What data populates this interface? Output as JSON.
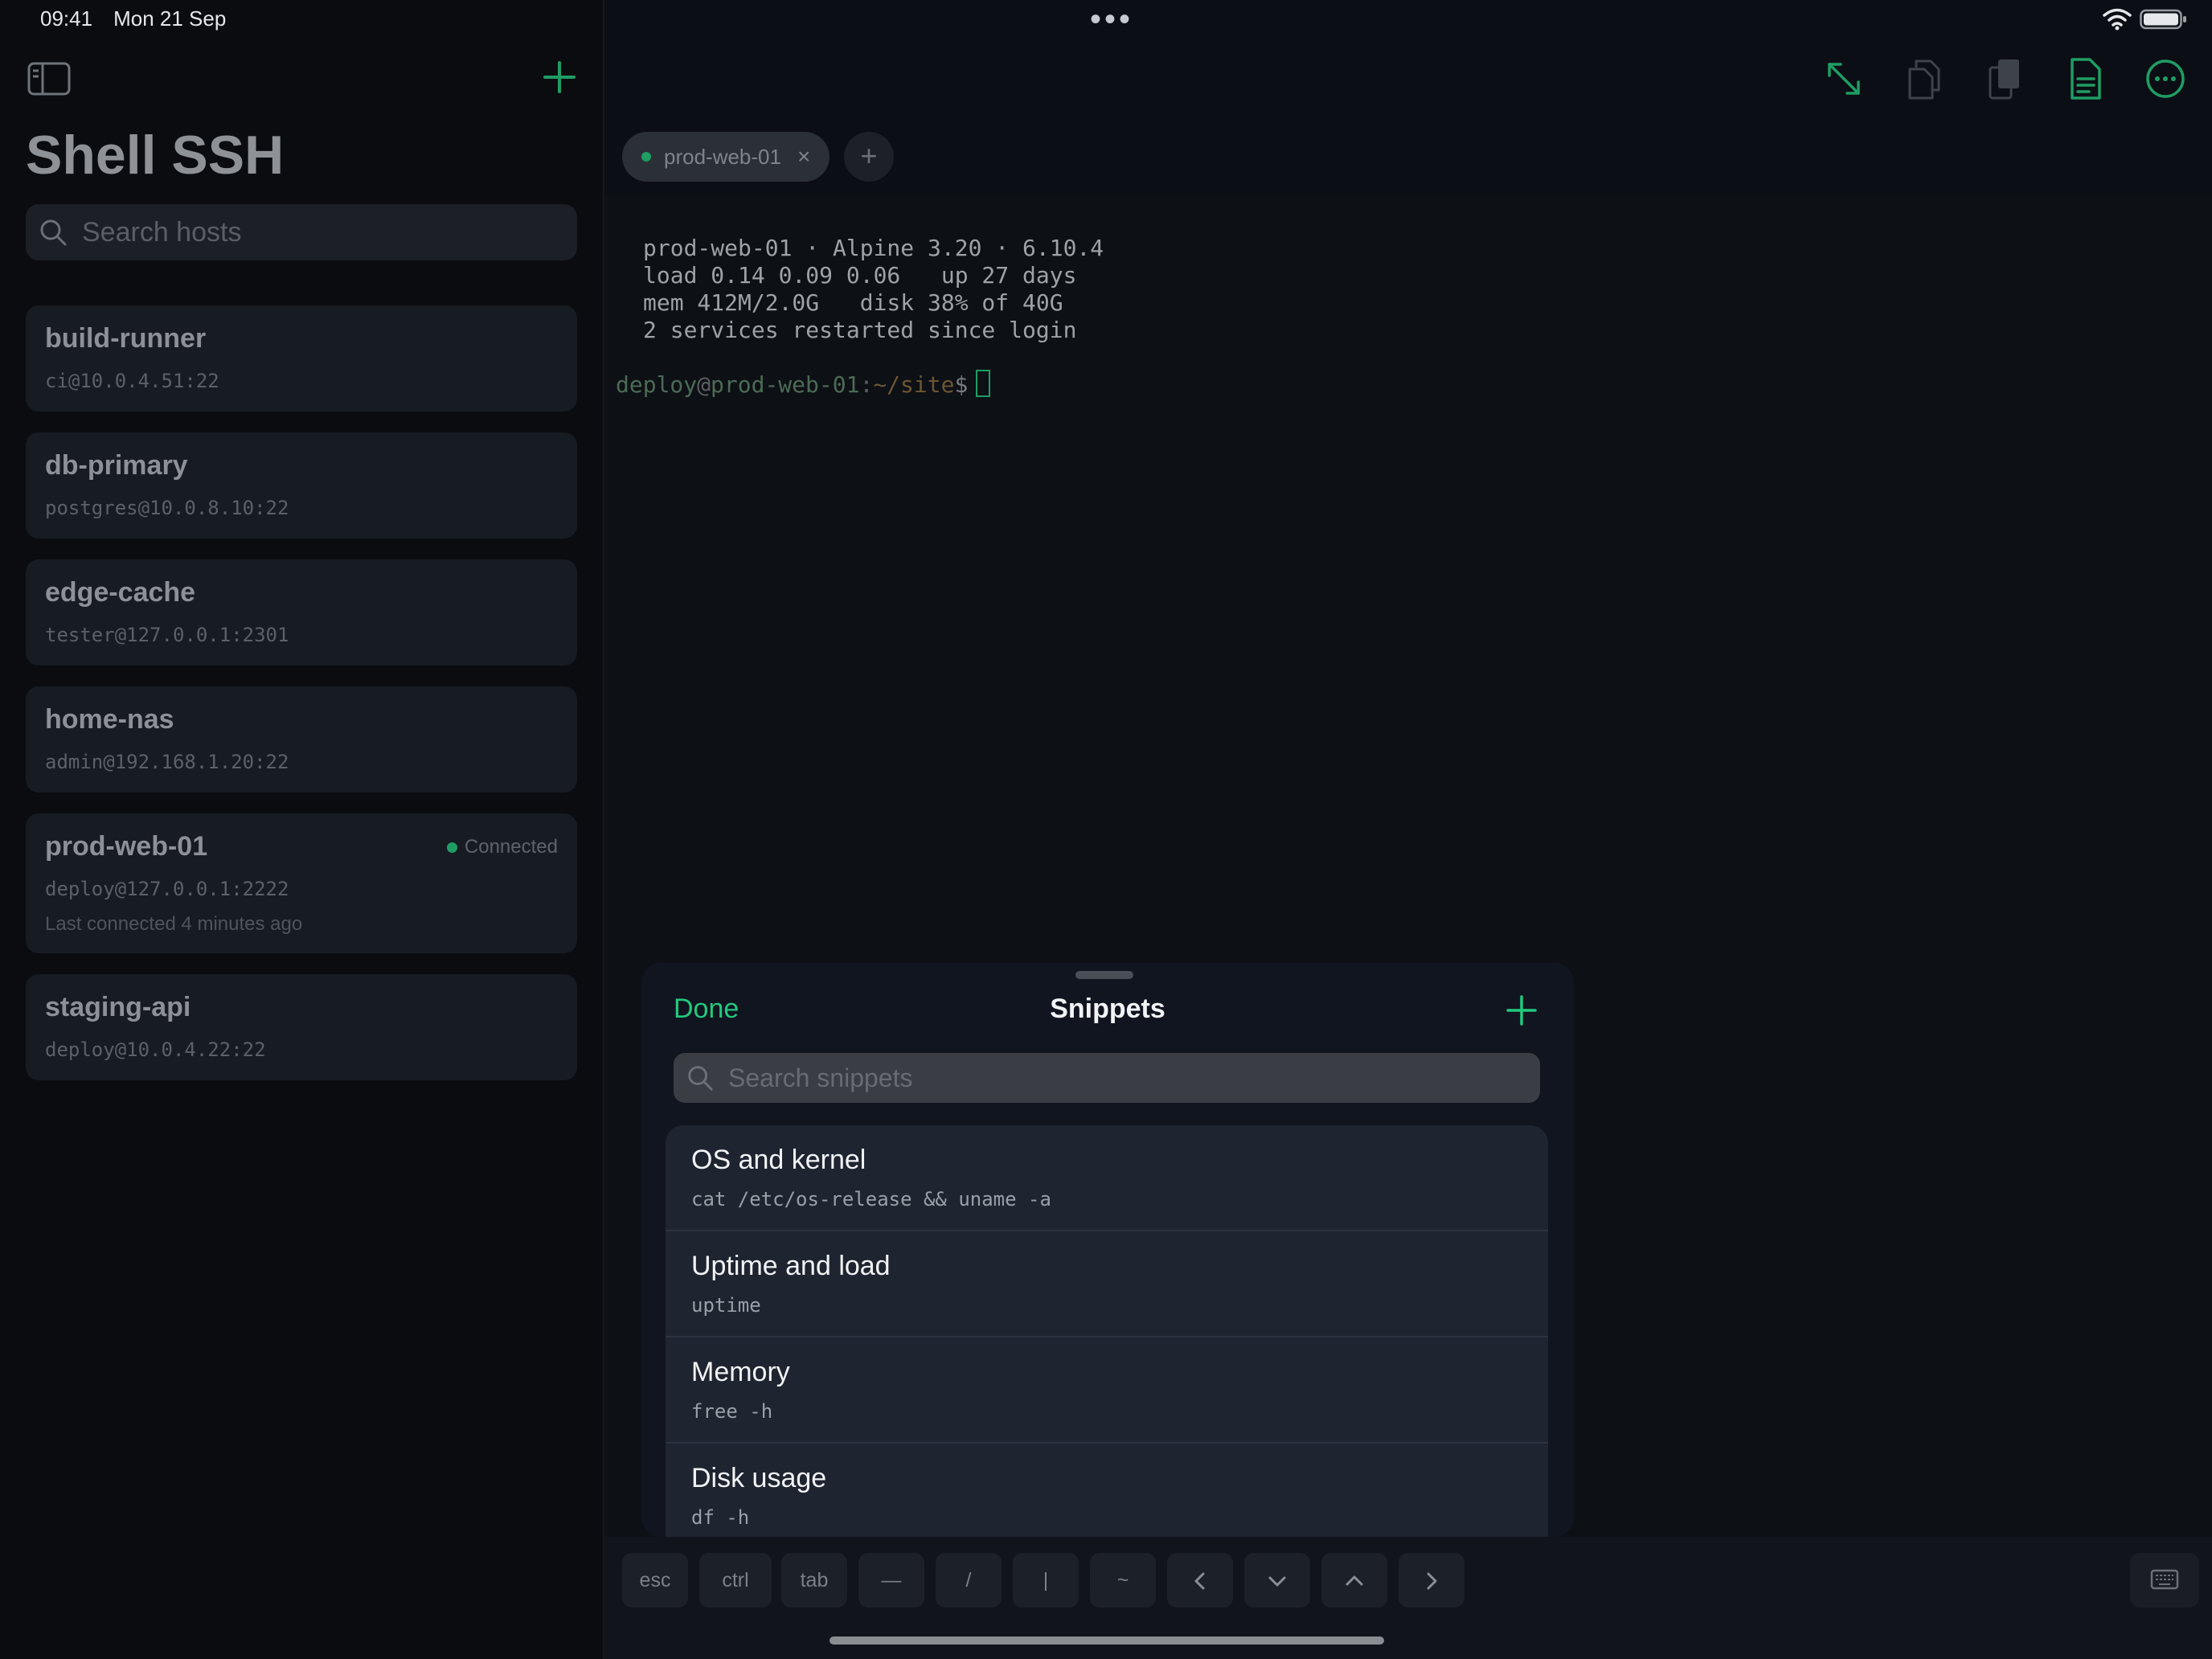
{
  "status": {
    "time": "09:41",
    "date": "Mon 21 Sep",
    "dots": "•••"
  },
  "sidebar": {
    "title": "Shell SSH",
    "search_placeholder": "Search hosts",
    "hosts": [
      {
        "name": "build-runner",
        "address": "ci@10.0.4.51:22"
      },
      {
        "name": "db-primary",
        "address": "postgres@10.0.8.10:22"
      },
      {
        "name": "edge-cache",
        "address": "tester@127.0.0.1:2301"
      },
      {
        "name": "home-nas",
        "address": "admin@192.168.1.20:22"
      },
      {
        "name": "prod-web-01",
        "address": "deploy@127.0.0.1:2222",
        "status": "Connected",
        "last_connected": "Last connected 4 minutes ago"
      },
      {
        "name": "staging-api",
        "address": "deploy@10.0.4.22:22"
      }
    ]
  },
  "tabs": [
    {
      "label": "prod-web-01",
      "close": "×"
    }
  ],
  "tab_add": "+",
  "terminal": {
    "motd": [
      "prod-web-01 · Alpine 3.20 · 6.10.4",
      "load 0.14 0.09 0.06   up 27 days",
      "mem 412M/2.0G   disk 38% of 40G",
      "2 services restarted since login"
    ],
    "prompt": {
      "user": "deploy",
      "at": "@",
      "host": "prod-web-01",
      "colon": ":",
      "path": "~/site",
      "symbol": "$"
    }
  },
  "snippets_sheet": {
    "done_label": "Done",
    "title": "Snippets",
    "search_placeholder": "Search snippets",
    "items": [
      {
        "name": "OS and kernel",
        "command": "cat /etc/os-release && uname -a"
      },
      {
        "name": "Uptime and load",
        "command": "uptime"
      },
      {
        "name": "Memory",
        "command": "free -h"
      },
      {
        "name": "Disk usage",
        "command": "df -h"
      }
    ]
  },
  "keybar": {
    "keys": [
      "esc",
      "ctrl",
      "tab",
      "—",
      "/",
      "|",
      "~"
    ]
  },
  "colors": {
    "accent": "#22c97d",
    "connected": "#1f9d64"
  }
}
